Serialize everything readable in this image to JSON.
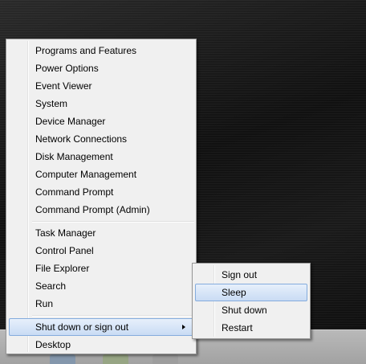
{
  "context_menu": {
    "group1": [
      "Programs and Features",
      "Power Options",
      "Event Viewer",
      "System",
      "Device Manager",
      "Network Connections",
      "Disk Management",
      "Computer Management",
      "Command Prompt",
      "Command Prompt (Admin)"
    ],
    "group2": [
      "Task Manager",
      "Control Panel",
      "File Explorer",
      "Search",
      "Run"
    ],
    "shutdown": "Shut down or sign out",
    "desktop": "Desktop"
  },
  "submenu": {
    "items": [
      "Sign out",
      "Sleep",
      "Shut down",
      "Restart"
    ],
    "highlighted": "Sleep"
  }
}
